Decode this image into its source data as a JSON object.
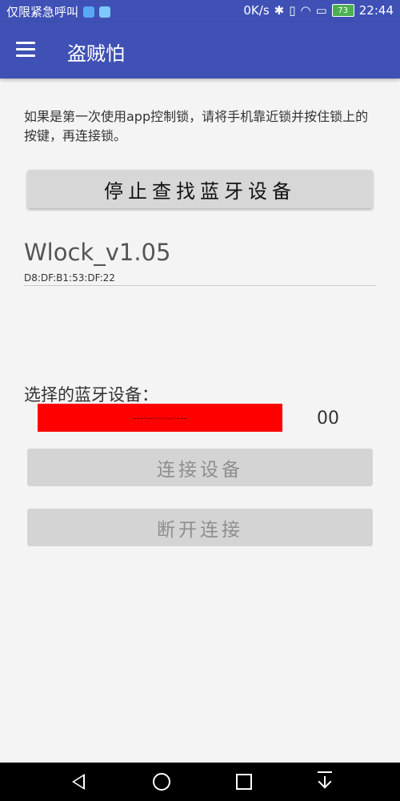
{
  "status_bar": {
    "carrier": "仅限紧急呼叫",
    "network_speed": "0K/s",
    "battery_level": "73",
    "time": "22:44",
    "icons": [
      "notification-app-icon",
      "notification-app-icon",
      "bluetooth-icon",
      "vibrate-icon",
      "wifi-icon",
      "sim-icon",
      "battery-icon"
    ]
  },
  "app_bar": {
    "title": "盗贼怕",
    "menu_icon": "menu-icon",
    "color": "#3f51b5"
  },
  "main": {
    "instruction": "如果是第一次使用app控制锁，请将手机靠近锁并按住锁上的按键，再连接锁。",
    "find_button": "停止查找蓝牙设备",
    "device_list": [
      {
        "name": "Wlock_v1.05",
        "mac": "D8:DF:B1:53:DF:22"
      }
    ],
    "selected_label": "选择的蓝牙设备：",
    "selected_value": "---·--·--·--·---",
    "selected_value_color": "#ff0000",
    "selected_extra": "00",
    "connect_button": "连接设备",
    "disconnect_button": "断开连接"
  },
  "nav_bar": {
    "icons": [
      "back-icon",
      "home-icon",
      "recent-apps-icon",
      "notification-pull-icon"
    ]
  }
}
